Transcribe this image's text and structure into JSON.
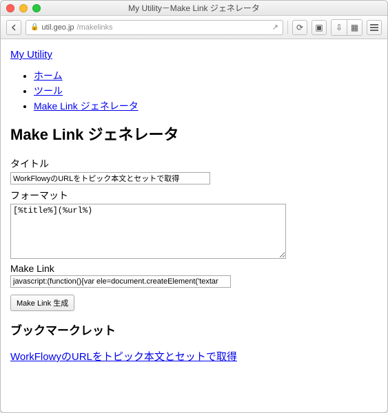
{
  "window": {
    "title": "My Utility－Make Link ジェネレータ"
  },
  "browser": {
    "lock_icon": "🔒",
    "url_domain": "util.geo.jp",
    "url_path": "/makelinks",
    "share_icon": "↗",
    "reload_icon": "⟳",
    "reader_icon": "▣",
    "download_icon": "⇩",
    "grid_icon": "▦"
  },
  "page": {
    "site_title": "My Utility",
    "nav": {
      "items": [
        {
          "label": "ホーム"
        },
        {
          "label": "ツール"
        },
        {
          "label": "Make Link ジェネレータ"
        }
      ]
    },
    "h1": "Make Link ジェネレータ",
    "fields": {
      "title_label": "タイトル",
      "title_value": "WorkFlowyのURLをトピック本文とセットで取得",
      "format_label": "フォーマット",
      "format_value": "[%title%](%url%)",
      "makelink_label": "Make Link",
      "makelink_value": "javascript:(function(){var ele=document.createElement('textar",
      "generate_button": "Make Link 生成"
    },
    "h2": "ブックマークレット",
    "bookmarklet_link": "WorkFlowyのURLをトピック本文とセットで取得"
  }
}
